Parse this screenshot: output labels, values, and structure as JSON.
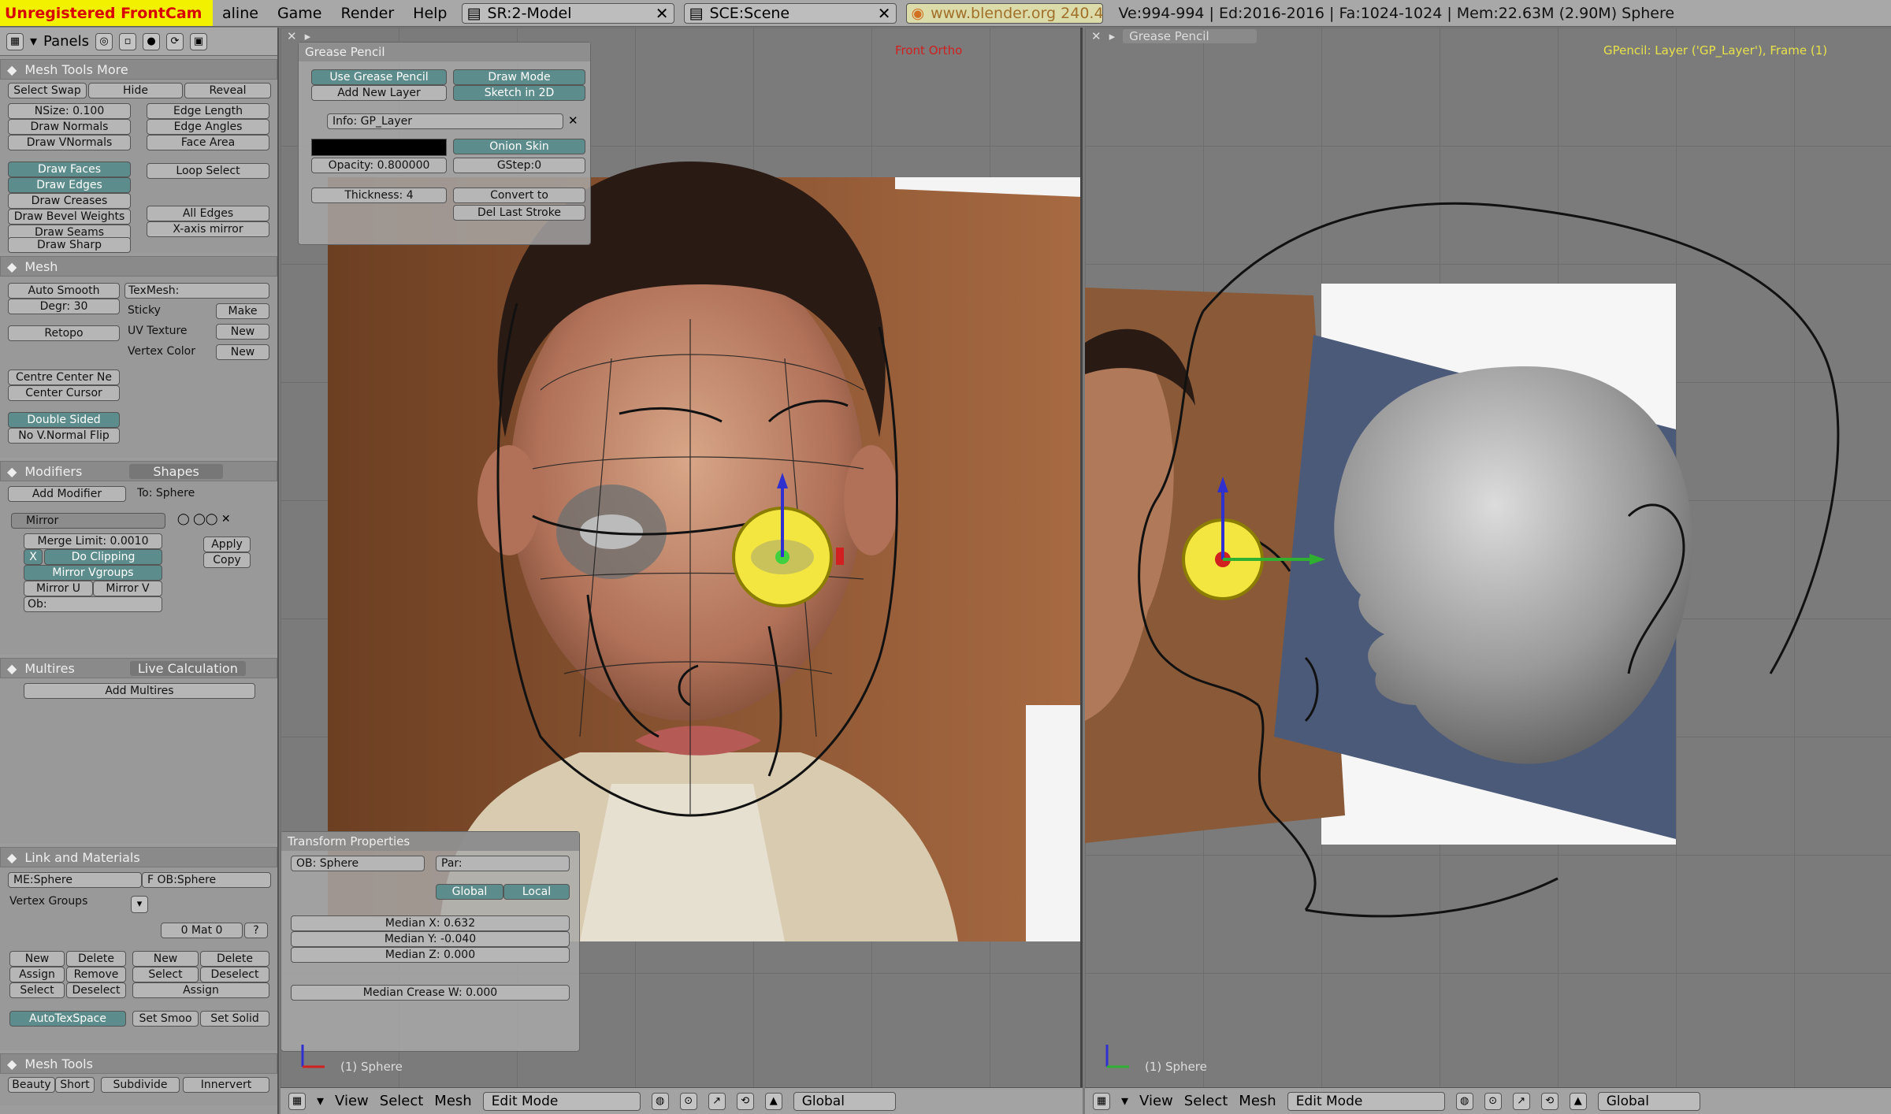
{
  "top": {
    "watermark": "Unregistered FrontCam",
    "menus": [
      "aline",
      "Game",
      "Render",
      "Help"
    ],
    "screen_select": "SR:2-Model",
    "scene_select": "SCE:Scene",
    "url": "www.blender.org 240.4",
    "stats": "Ve:994-994 | Ed:2016-2016 | Fa:1024-1024 | Mem:22.63M (2.90M) Sphere"
  },
  "side": {
    "header_label": "Panels",
    "mesh_tools_more": {
      "title": "Mesh Tools More",
      "select_swap": "Select Swap",
      "hide": "Hide",
      "reveal": "Reveal",
      "nsize": "NSize: 0.100",
      "draw_normals": "Draw Normals",
      "draw_vnormals": "Draw VNormals",
      "edge_length": "Edge Length",
      "edge_angles": "Edge Angles",
      "face_area": "Face Area",
      "draw_faces": "Draw Faces",
      "draw_edges": "Draw Edges",
      "draw_creases": "Draw Creases",
      "draw_bevel_weights": "Draw Bevel Weights",
      "draw_seams": "Draw Seams",
      "draw_sharp": "Draw Sharp",
      "loop_select": "Loop Select",
      "all_edges": "All Edges",
      "x_axis_mirror": "X-axis mirror"
    },
    "mesh": {
      "title": "Mesh",
      "auto_smooth": "Auto Smooth",
      "degr": "Degr: 30",
      "texmesh": "TexMesh:",
      "sticky": "Sticky",
      "make": "Make",
      "uv_texture": "UV Texture",
      "vertex_color": "Vertex Color",
      "new1": "New",
      "new2": "New",
      "retopo": "Retopo",
      "centre_center_new": "Centre Center Ne",
      "center_cursor": "Center Cursor",
      "double_sided": "Double Sided",
      "no_v_normal_flip": "No V.Normal Flip"
    },
    "modifiers": {
      "title": "Modifiers",
      "tab2": "Shapes",
      "add_modifier": "Add Modifier",
      "to_sphere": "To: Sphere",
      "mirror": "Mirror",
      "merge_limit": "Merge Limit: 0.0010",
      "x": "X",
      "do_clipping": "Do Clipping",
      "mirror_vgroups": "Mirror Vgroups",
      "mirror_u": "Mirror U",
      "mirror_v": "Mirror V",
      "ob": "Ob:",
      "apply": "Apply",
      "copy": "Copy"
    },
    "multires": {
      "title": "Multires",
      "tab2": "Live Calculation",
      "add_multires": "Add Multires"
    },
    "link_materials": {
      "title": "Link and Materials",
      "me": "ME:Sphere",
      "ob": "F OB:Sphere",
      "vertex_groups": "Vertex Groups",
      "mat": "0 Mat 0",
      "q": "?",
      "new1": "New",
      "delete1": "Delete",
      "new2": "New",
      "delete2": "Delete",
      "assign1": "Assign",
      "remove": "Remove",
      "select1": "Select",
      "deselect1": "Deselect",
      "select2": "Select",
      "deselect2": "Deselect",
      "assign2": "Assign",
      "autotexspace": "AutoTexSpace",
      "set_smoo": "Set Smoo",
      "set_solid": "Set Solid"
    },
    "mesh_tools": {
      "title": "Mesh Tools",
      "beauty": "Beauty",
      "short": "Short",
      "subdivide": "Subdivide",
      "innervert": "Innervert"
    }
  },
  "vp1": {
    "grease_title": "Grease Pencil",
    "red_label": "Front Ortho",
    "use_grease_pencil": "Use Grease Pencil",
    "draw_mode": "Draw Mode",
    "add_new_layer": "Add New Layer",
    "sketch_in_2d": "Sketch in 2D",
    "layer_name": "Info: GP_Layer",
    "onion_skin": "Onion Skin",
    "opacity": "Opacity: 0.800000",
    "gstep": "GStep:0",
    "thickness": "Thickness: 4",
    "convert_to": "Convert to",
    "del_last_stroke": "Del Last Stroke",
    "tp_title": "Transform Properties",
    "tp_ob": "OB: Sphere",
    "tp_par": "Par:",
    "tp_global": "Global",
    "tp_local": "Local",
    "median_x": "Median X: 0.632",
    "median_y": "Median Y: -0.040",
    "median_z": "Median Z: 0.000",
    "median_crease": "Median Crease W: 0.000",
    "obj_label": "(1) Sphere"
  },
  "vp2": {
    "grease_title": "Grease Pencil",
    "gp_info": "GPencil: Layer ('GP_Layer'), Frame (1)",
    "obj_label": "(1) Sphere"
  },
  "status1": {
    "view": "View",
    "select": "Select",
    "mesh": "Mesh",
    "mode": "Edit Mode",
    "orient": "Global"
  },
  "status2": {
    "view": "View",
    "select": "Select",
    "mesh": "Mesh",
    "mode": "Edit Mode",
    "orient": "Global"
  },
  "colors": {
    "accent_toggle": "#5d8c8c",
    "watermark_bg": "#f2f200",
    "watermark_fg": "#d80000",
    "gp_info": "#e8e24a"
  }
}
